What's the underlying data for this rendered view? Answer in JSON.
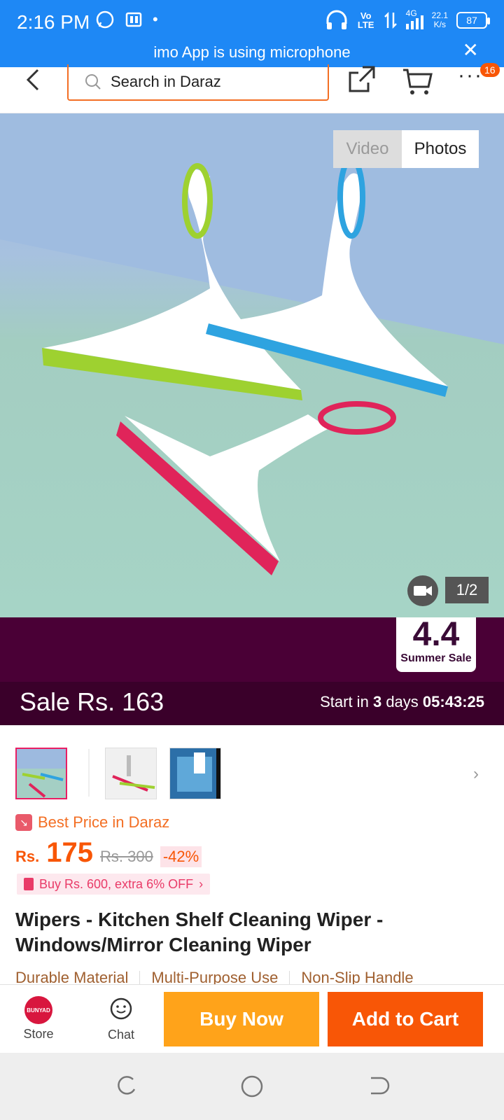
{
  "status_bar": {
    "time": "2:16 PM",
    "network_type": "4G",
    "volte": "Vo LTE",
    "speed_value": "22.1",
    "speed_unit": "K/s",
    "battery": "87",
    "mic_notice": "imo App is using microphone"
  },
  "top_nav": {
    "search_placeholder": "Search in Daraz",
    "more_badge": "16"
  },
  "gallery": {
    "tabs": [
      "Video",
      "Photos"
    ],
    "selected_tab": "Photos",
    "page_indicator": "1/2"
  },
  "sale_banner": {
    "badge_number": "4.4",
    "badge_text": "Summer Sale",
    "sale_label": "Sale",
    "sale_price": "Rs. 163",
    "countdown_prefix": "Start in",
    "countdown_days": "3",
    "countdown_days_label": "days",
    "countdown_time": "05:43:25"
  },
  "product": {
    "best_price_label": "Best Price in Daraz",
    "currency": "Rs.",
    "price": "175",
    "original_price": "Rs. 300",
    "discount": "-42%",
    "promo": "Buy Rs. 600, extra 6% OFF",
    "title": "Wipers - Kitchen Shelf Cleaning Wiper - Windows/Mirror Cleaning Wiper",
    "features": [
      "Durable Material",
      "Multi-Purpose Use",
      "Non-Slip Handle"
    ]
  },
  "action_bar": {
    "store_logo": "BUNYAD",
    "store_label": "Store",
    "chat_label": "Chat",
    "buy_now": "Buy Now",
    "add_to_cart": "Add to Cart"
  },
  "colors": {
    "status_bar": "#1E88F5",
    "brand_orange": "#F85606",
    "buy_now": "#FFA31A",
    "sale_banner": "#4a0036"
  }
}
